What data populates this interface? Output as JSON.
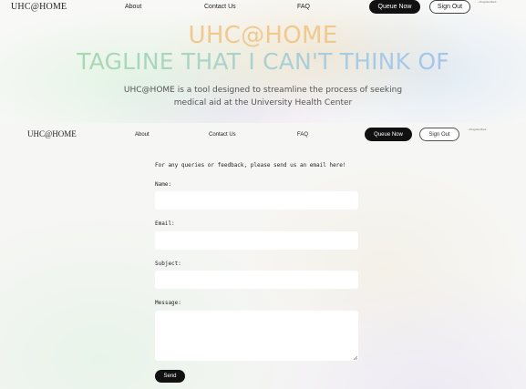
{
  "header": {
    "logo": "UHC@HOME",
    "nav": [
      "About",
      "Contact Us",
      "FAQ"
    ],
    "queue_button": "Queue Now",
    "signout_button": "Sign Out",
    "user_tag": "~thingidentified"
  },
  "hero": {
    "title": "UHC@HOME",
    "tagline": "TAGLINE THAT I CAN'T THINK OF",
    "description": "UHC@HOME is a tool designed to streamline the process of seeking medical aid at the University Health Center"
  },
  "header2": {
    "logo": "UHC@HOME",
    "nav": [
      "About",
      "Contact Us",
      "FAQ"
    ],
    "queue_button": "Queue Now",
    "signout_button": "Sign Out",
    "user_tag": "~thingidentified"
  },
  "contact_form": {
    "intro": "For any queries or feedback, please send us an email here!",
    "fields": [
      {
        "label": "Name:",
        "value": ""
      },
      {
        "label": "Email:",
        "value": ""
      },
      {
        "label": "Subject:",
        "value": ""
      },
      {
        "label": "Message:",
        "value": ""
      }
    ],
    "send_button": "Send"
  },
  "colors": {
    "title": "#f1c98f",
    "tagline_start": "#a8dca0",
    "tagline_end": "#a3b9e6",
    "button_dark": "#111111"
  }
}
